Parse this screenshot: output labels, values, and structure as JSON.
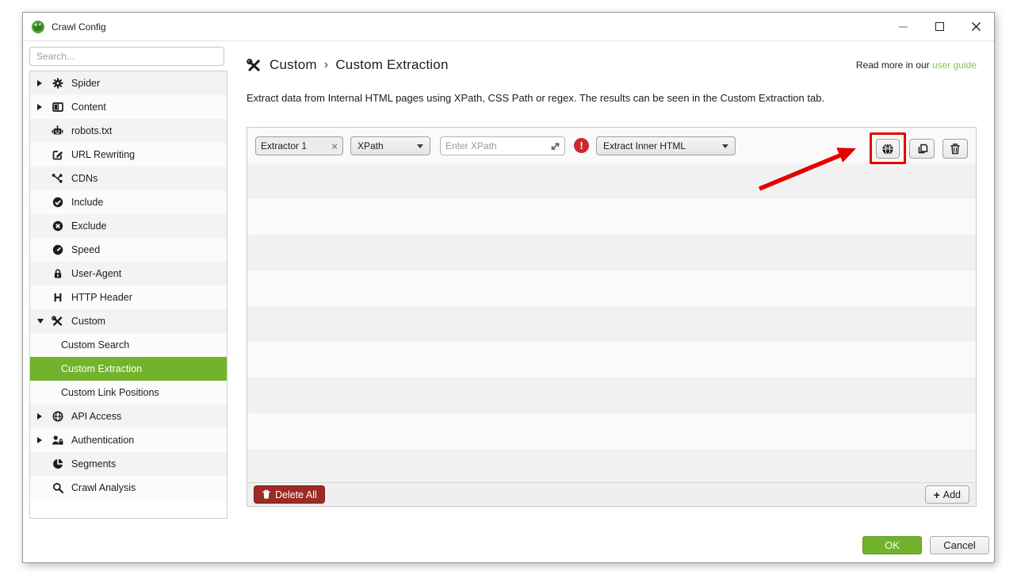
{
  "window": {
    "title": "Crawl Config"
  },
  "sidebar": {
    "search_placeholder": "Search...",
    "items": [
      {
        "label": "Spider",
        "icon": "gear-icon",
        "expandable": true
      },
      {
        "label": "Content",
        "icon": "columns-icon",
        "expandable": true
      },
      {
        "label": "robots.txt",
        "icon": "robot-icon"
      },
      {
        "label": "URL Rewriting",
        "icon": "edit-icon"
      },
      {
        "label": "CDNs",
        "icon": "network-icon"
      },
      {
        "label": "Include",
        "icon": "check-circle-icon"
      },
      {
        "label": "Exclude",
        "icon": "cross-circle-icon"
      },
      {
        "label": "Speed",
        "icon": "speedometer-icon"
      },
      {
        "label": "User-Agent",
        "icon": "agent-lock-icon"
      },
      {
        "label": "HTTP Header",
        "icon": "h-icon"
      },
      {
        "label": "Custom",
        "icon": "tools-icon",
        "expandable": true,
        "expanded": true
      },
      {
        "label": "Custom Search",
        "child": true
      },
      {
        "label": "Custom Extraction",
        "child": true,
        "selected": true
      },
      {
        "label": "Custom Link Positions",
        "child": true
      },
      {
        "label": "API Access",
        "icon": "globe-icon",
        "expandable": true
      },
      {
        "label": "Authentication",
        "icon": "user-lock-icon",
        "expandable": true
      },
      {
        "label": "Segments",
        "icon": "pie-icon"
      },
      {
        "label": "Crawl Analysis",
        "icon": "magnifier-icon"
      }
    ]
  },
  "main": {
    "breadcrumb": {
      "parent": "Custom",
      "separator": "›",
      "current": "Custom Extraction"
    },
    "read_more_prefix": "Read more in our ",
    "read_more_link": "user guide",
    "description": "Extract data from Internal HTML pages using XPath, CSS Path or regex. The results can be seen in the Custom Extraction tab."
  },
  "extractor_row": {
    "name_value": "Extractor 1",
    "clear_glyph": "×",
    "type_selected": "XPath",
    "xpath_placeholder": "Enter XPath",
    "error_glyph": "!",
    "mode_selected": "Extract Inner HTML"
  },
  "panel_footer": {
    "delete_all_label": "Delete All",
    "add_plus": "+",
    "add_label": "Add"
  },
  "footer": {
    "ok_label": "OK",
    "cancel_label": "Cancel"
  },
  "icons": {
    "app-icon": "green frog logo",
    "gear-icon": "gear",
    "columns-icon": "two columns",
    "robot-icon": "robot head",
    "edit-icon": "square with pencil",
    "network-icon": "connected nodes",
    "check-circle-icon": "check in filled circle",
    "cross-circle-icon": "x in filled circle",
    "speedometer-icon": "gauge",
    "agent-lock-icon": "padlock",
    "h-icon": "letter H",
    "tools-icon": "crossed wrench and screwdriver",
    "globe-icon": "globe outline",
    "user-lock-icon": "person with padlock",
    "pie-icon": "pie chart",
    "magnifier-icon": "magnifying glass",
    "browser-icon": "filled globe",
    "duplicate-icon": "two overlapping sheets",
    "trash-icon": "trash bin",
    "expand-xpath-icon": "diagonal resize arrow",
    "error-icon": "exclamation in red circle",
    "minimize-icon": "horizontal bar",
    "maximize-icon": "square outline",
    "close-icon": "x cross",
    "expand-arrow-icon": "triangle right/down",
    "caret-down-icon": "triangle down"
  },
  "colors": {
    "accent_green": "#72b32d",
    "link_green": "#8bc34a",
    "error_red": "#cd2a2a",
    "delete_red": "#9c2b23",
    "annotation_red": "#e60000"
  }
}
